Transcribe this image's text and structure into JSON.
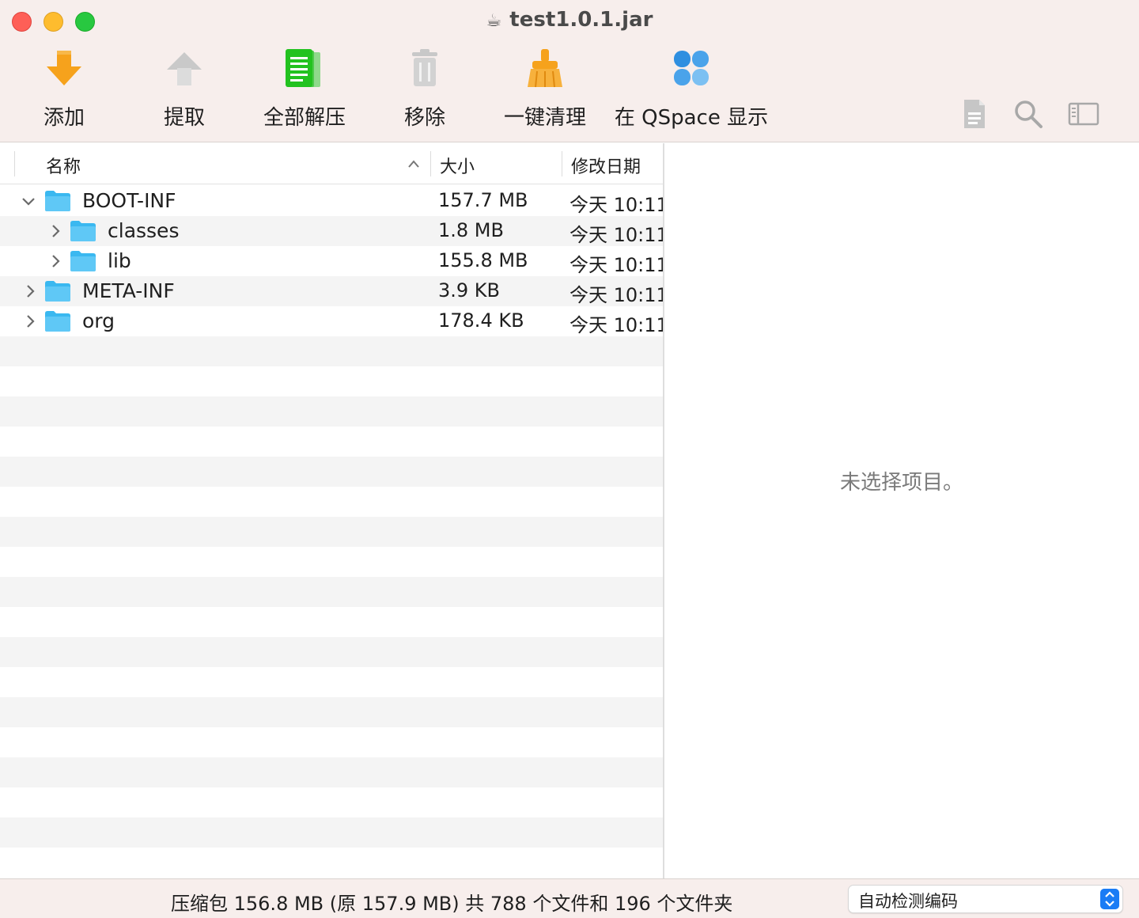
{
  "window": {
    "title": "test1.0.1.jar",
    "title_icon": "coffee-cup-icon"
  },
  "toolbar": {
    "add_label": "添加",
    "extract_label": "提取",
    "extract_all_label": "全部解压",
    "remove_label": "移除",
    "clean_label": "一键清理",
    "qspace_label": "在 QSpace 显示",
    "icons": {
      "add": "download-arrow-icon",
      "extract": "upload-arrow-icon",
      "extract_all": "documents-icon",
      "remove": "trash-icon",
      "clean": "broom-icon",
      "qspace": "qspace-clover-icon",
      "info": "document-info-icon",
      "search": "search-icon",
      "sidebar": "sidebar-toggle-icon"
    },
    "colors": {
      "add": "#f6a21c",
      "extract_all": "#22c21f",
      "clean": "#f6a21c",
      "qspace": "#2f8fe0"
    }
  },
  "columns": {
    "name": "名称",
    "size": "大小",
    "modified": "修改日期"
  },
  "files": [
    {
      "name": "BOOT-INF",
      "size": "157.7 MB",
      "date": "今天 10:11"
    },
    {
      "name": "classes",
      "size": "1.8 MB",
      "date": "今天 10:11"
    },
    {
      "name": "lib",
      "size": "155.8 MB",
      "date": "今天 10:11"
    },
    {
      "name": "META-INF",
      "size": "3.9 KB",
      "date": "今天 10:11"
    },
    {
      "name": "org",
      "size": "178.4 KB",
      "date": "今天 10:11"
    }
  ],
  "preview": {
    "empty_text": "未选择项目。"
  },
  "status": {
    "summary": "压缩包 156.8 MB (原 157.9 MB) 共 788 个文件和 196 个文件夹",
    "encoding": "自动检测编码"
  },
  "colors": {
    "folder": "#3ab8f0",
    "accent": "#1a7cf5"
  }
}
